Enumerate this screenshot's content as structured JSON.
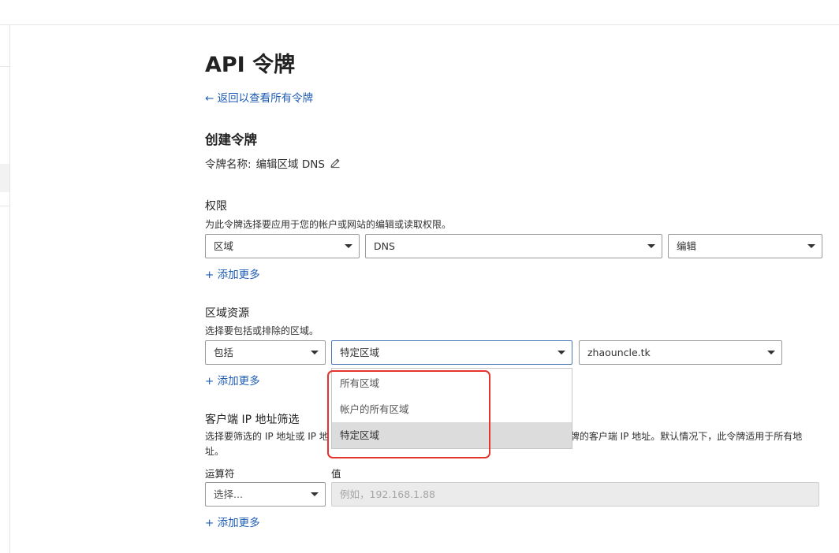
{
  "page": {
    "title": "API 令牌",
    "back_link": "← 返回以查看所有令牌"
  },
  "create": {
    "heading": "创建令牌",
    "token_name_label": "令牌名称:",
    "token_name_value": "编辑区域 DNS"
  },
  "permissions": {
    "title": "权限",
    "description": "为此令牌选择要应用于您的帐户或网站的编辑或读取权限。",
    "selects": [
      "区域",
      "DNS",
      "编辑"
    ],
    "add_more": "+ 添加更多"
  },
  "zone_resources": {
    "title": "区域资源",
    "description": "选择要包括或排除的区域。",
    "selects": [
      "包括",
      "特定区域",
      "zhaouncle.tk"
    ],
    "add_more": "+ 添加更多",
    "dropdown_options": [
      "所有区域",
      "帐户的所有区域",
      "特定区域"
    ],
    "dropdown_selected_index": 2
  },
  "ip_filter": {
    "title": "客户端 IP 地址筛选",
    "description_left": "选择要筛选的 IP 地址或 IP 地",
    "description_right": "牌的客户端 IP 地址。默认情况下，此令牌适用于所有地",
    "description_line2": "址。",
    "operator_label": "运算符",
    "value_label": "值",
    "operator_select": "选择...",
    "value_placeholder": "例如，192.168.1.88",
    "add_more": "+ 添加更多"
  },
  "colors": {
    "link": "#1f5cb3",
    "highlight": "#e5342b",
    "selected_option_bg": "#dcdcdc"
  },
  "icons": {
    "edit": "pencil-icon",
    "select_caret": "caret-down-icon"
  }
}
